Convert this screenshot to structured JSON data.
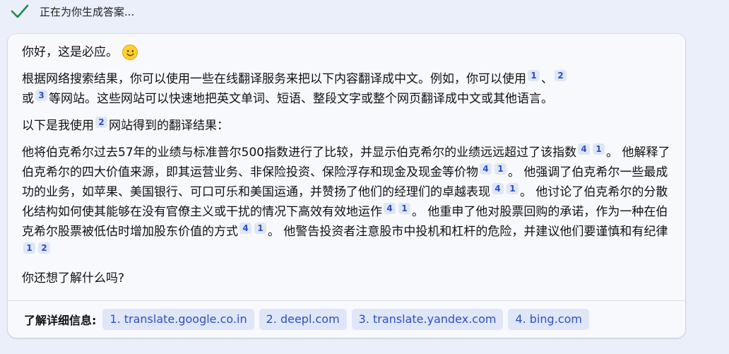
{
  "status": {
    "icon": "checkmark-icon",
    "text": "正在为你生成答案..."
  },
  "message": {
    "greeting": "你好，这是必应。",
    "emoji": "smile-emoji-icon",
    "para1_a": "根据网络搜索结果，你可以使用一些在线翻译服务来把以下内容翻译成中文。例如，你可以使用",
    "para1_b": "、",
    "para1_c": "或",
    "para1_d": "等网站。这些网站可以快速地把英文单词、短语、整段文字或整个网页翻译成中文或其他语言。",
    "para2_a": "以下是我使用",
    "para2_b": "网站得到的翻译结果：",
    "para3_s1": "他将伯克希尔过去57年的业绩与标准普尔500指数进行了比较，并显示伯克希尔的业绩远远超过了该指数",
    "para3_s2": "。 他解释了伯克希尔的四大价值来源，即其运营业务、非保险投资、保险浮存和现金及现金等价物",
    "para3_s3": "。 他强调了伯克希尔一些最成功的业务，如苹果、美国银行、可口可乐和美国运通，并赞扬了他们的经理们的卓越表现",
    "para3_s4": "。 他讨论了伯克希尔的分散化结构如何使其能够在没有官僚主义或干扰的情况下高效有效地运作",
    "para3_s5": "。 他重申了他对股票回购的承诺，作为一种在伯克希尔股票被低估时增加股东价值的方式",
    "para3_s6": "。 他警告投资者注意股市中投机和杠杆的危险，并建议他们要谨慎和有纪律",
    "closing": "你还想了解什么吗?",
    "cite_1": "1",
    "cite_2": "2",
    "cite_3": "3",
    "cite_4": "4"
  },
  "footer": {
    "label": "了解详细信息:",
    "links": [
      "1. translate.google.co.in",
      "2. deepl.com",
      "3. translate.yandex.com",
      "4. bing.com"
    ]
  },
  "colors": {
    "accent": "#2c4fc9",
    "chip_bg": "#dfe6f7",
    "check": "#1f8a4c",
    "page_bg": "#eaeff9"
  }
}
